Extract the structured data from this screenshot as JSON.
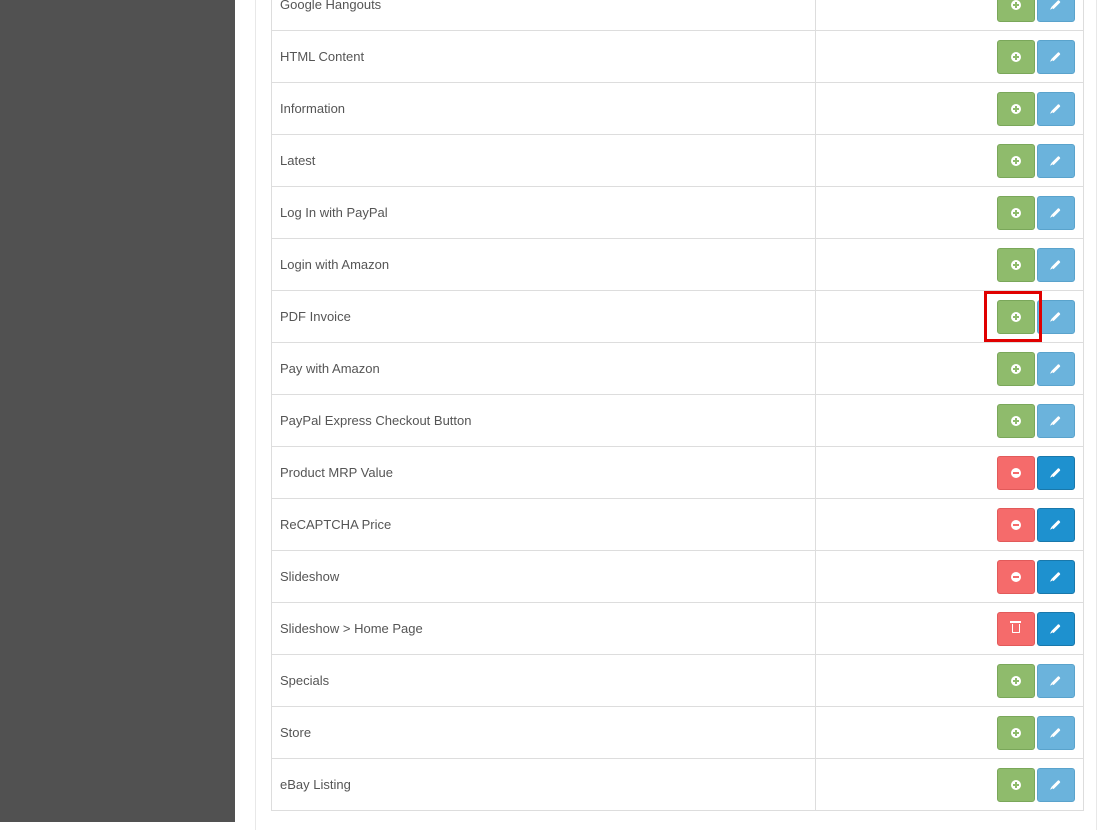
{
  "extensions": [
    {
      "name": "Google Hangouts",
      "status": "install",
      "edit_style": "light"
    },
    {
      "name": "HTML Content",
      "status": "install",
      "edit_style": "light"
    },
    {
      "name": "Information",
      "status": "install",
      "edit_style": "light"
    },
    {
      "name": "Latest",
      "status": "install",
      "edit_style": "light"
    },
    {
      "name": "Log In with PayPal",
      "status": "install",
      "edit_style": "light"
    },
    {
      "name": "Login with Amazon",
      "status": "install",
      "edit_style": "light"
    },
    {
      "name": "PDF Invoice",
      "status": "install",
      "edit_style": "light"
    },
    {
      "name": "Pay with Amazon",
      "status": "install",
      "edit_style": "light"
    },
    {
      "name": "PayPal Express Checkout Button",
      "status": "install",
      "edit_style": "light"
    },
    {
      "name": "Product MRP Value",
      "status": "uninstall",
      "edit_style": "dark"
    },
    {
      "name": "ReCAPTCHA Price",
      "status": "uninstall",
      "edit_style": "dark"
    },
    {
      "name": "Slideshow",
      "status": "uninstall",
      "edit_style": "dark"
    },
    {
      "name": "Slideshow > Home Page",
      "status": "delete",
      "edit_style": "dark"
    },
    {
      "name": "Specials",
      "status": "install",
      "edit_style": "light"
    },
    {
      "name": "Store",
      "status": "install",
      "edit_style": "light"
    },
    {
      "name": "eBay Listing",
      "status": "install",
      "edit_style": "light"
    }
  ],
  "icons": {
    "install": "plus-circle-icon",
    "uninstall": "minus-circle-icon",
    "delete": "trash-icon",
    "edit": "pencil-icon"
  },
  "colors": {
    "install": "#8fbb6c",
    "uninstall": "#f56b6b",
    "edit_light": "#6bb3dc",
    "edit_dark": "#1e91cf",
    "sidebar": "#515151",
    "highlight": "#e00000"
  },
  "highlighted_row": "PDF Invoice"
}
